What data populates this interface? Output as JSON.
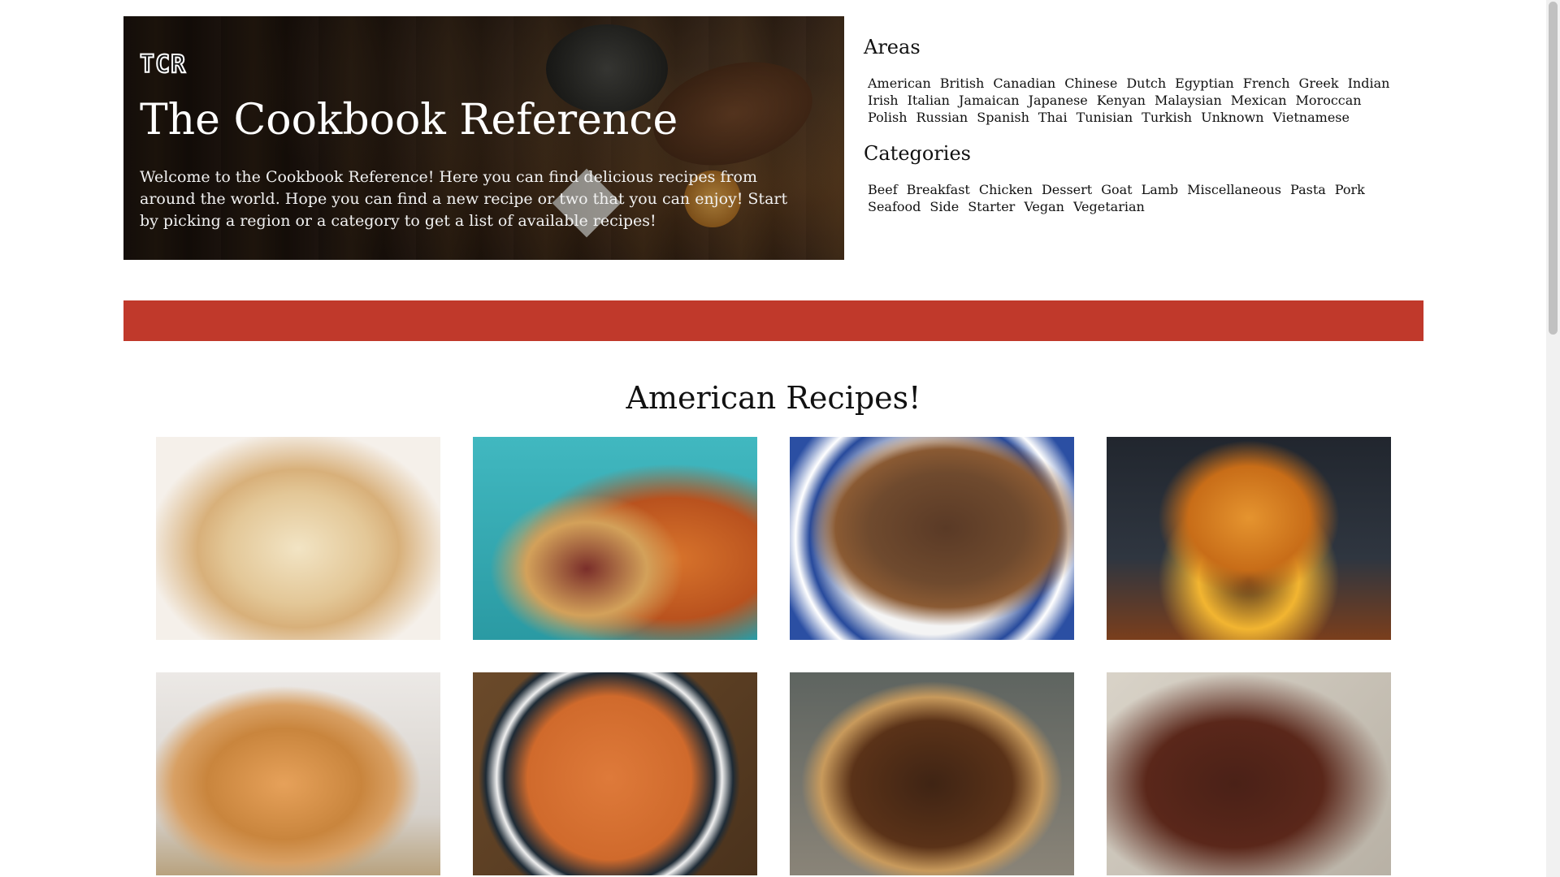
{
  "hero": {
    "logo": "TCR",
    "title": "The Cookbook Reference",
    "intro": "Welcome to the Cookbook Reference! Here you can find delicious recipes from around the world. Hope you can find a new recipe or two that you can enjoy! Start by picking a region or a category to get a list of available recipes!"
  },
  "areas": {
    "heading": "Areas",
    "items": [
      "American",
      "British",
      "Canadian",
      "Chinese",
      "Dutch",
      "Egyptian",
      "French",
      "Greek",
      "Indian",
      "Irish",
      "Italian",
      "Jamaican",
      "Japanese",
      "Kenyan",
      "Malaysian",
      "Mexican",
      "Moroccan",
      "Polish",
      "Russian",
      "Spanish",
      "Thai",
      "Tunisian",
      "Turkish",
      "Unknown",
      "Vietnamese"
    ]
  },
  "categories": {
    "heading": "Categories",
    "items": [
      "Beef",
      "Breakfast",
      "Chicken",
      "Dessert",
      "Goat",
      "Lamb",
      "Miscellaneous",
      "Pasta",
      "Pork",
      "Seafood",
      "Side",
      "Starter",
      "Vegan",
      "Vegetarian"
    ]
  },
  "band_color": "#c0392b",
  "recipes_section": {
    "title": "American Recipes!",
    "cards": [
      {
        "image": "pancakes-stack-photo"
      },
      {
        "image": "pulled-pork-sandwich-fries-photo"
      },
      {
        "image": "beef-brisket-platter-photo"
      },
      {
        "image": "double-cheeseburger-photo"
      },
      {
        "image": "chicken-sandwich-photo"
      },
      {
        "image": "penne-pasta-bowl-photo"
      },
      {
        "image": "pecan-pie-photo"
      },
      {
        "image": "chocolate-brownies-photo"
      }
    ]
  }
}
